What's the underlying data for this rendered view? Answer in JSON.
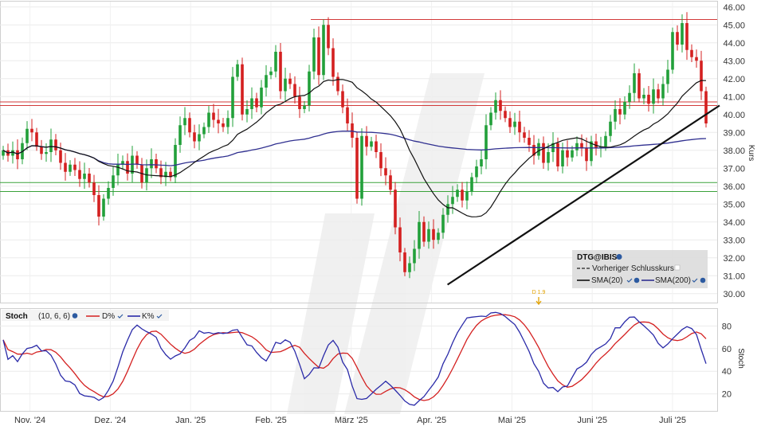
{
  "chart_data": [
    {
      "type": "candlestick",
      "instrument": "DTG@IBIS",
      "ylabel": "Kurs",
      "ylim": [
        29.5,
        46.3
      ],
      "y_ticks": [
        "30.00",
        "31.00",
        "32.00",
        "33.00",
        "34.00",
        "35.00",
        "36.00",
        "37.00",
        "38.00",
        "39.00",
        "40.00",
        "41.00",
        "42.00",
        "43.00",
        "44.00",
        "45.00",
        "46.00"
      ],
      "x_labels": [
        "Nov. '24",
        "Dez. '24",
        "Jan. '25",
        "Feb. '25",
        "März '25",
        "Apr. '25",
        "Mai '25",
        "Juni '25",
        "Juli '25"
      ],
      "event_marker": "D 1.9",
      "horizontal_levels": [
        {
          "value": 45.3,
          "color": "#d23a3a"
        },
        {
          "value": 40.7,
          "color": "#d23a3a"
        },
        {
          "value": 40.5,
          "color": "#d23a3a"
        },
        {
          "value": 36.2,
          "color": "#3aa23a"
        },
        {
          "value": 35.7,
          "color": "#3aa23a"
        }
      ],
      "trendline": {
        "from": {
          "x": "Apr. '25",
          "y": 30.5
        },
        "to": {
          "x": "Juli '25 end",
          "y": 40.5
        }
      },
      "closes": [
        38.0,
        37.7,
        38.0,
        37.5,
        38.4,
        39.2,
        39.0,
        38.2,
        37.8,
        37.9,
        38.6,
        38.0,
        37.3,
        36.8,
        37.2,
        36.9,
        36.4,
        36.7,
        36.2,
        35.5,
        34.3,
        35.3,
        35.9,
        36.6,
        37.2,
        37.4,
        36.7,
        37.7,
        37.2,
        36.2,
        37.0,
        37.5,
        37.0,
        36.5,
        36.8,
        36.5,
        38.3,
        39.4,
        39.8,
        39.0,
        38.5,
        38.9,
        39.3,
        40.1,
        39.7,
        39.5,
        39.3,
        39.8,
        42.1,
        42.8,
        40.0,
        40.3,
        40.9,
        40.4,
        41.5,
        42.2,
        42.4,
        43.5,
        41.3,
        42.0,
        41.7,
        41.0,
        40.3,
        40.5,
        42.4,
        44.3,
        42.2,
        45.0,
        43.7,
        42.1,
        41.3,
        40.4,
        39.5,
        38.7,
        35.3,
        38.8,
        38.2,
        38.5,
        37.9,
        37.0,
        36.6,
        35.8,
        33.7,
        32.3,
        31.2,
        31.7,
        32.5,
        34.0,
        32.9,
        33.6,
        33.0,
        33.4,
        34.4,
        35.0,
        35.4,
        35.8,
        35.2,
        35.7,
        36.5,
        37.1,
        37.5,
        39.4,
        40.1,
        40.8,
        40.2,
        39.8,
        39.3,
        39.6,
        39.0,
        38.7,
        38.3,
        37.7,
        38.4,
        37.3,
        37.9,
        38.4,
        37.1,
        38.0,
        37.6,
        38.0,
        38.4,
        38.1,
        37.4,
        38.5,
        38.1,
        38.2,
        38.8,
        39.6,
        40.3,
        40.0,
        40.7,
        41.2,
        42.3,
        40.9,
        41.1,
        40.6,
        41.4,
        40.9,
        41.7,
        42.5,
        44.6,
        43.9,
        45.1,
        43.6,
        43.2,
        43.0,
        41.3,
        39.5
      ],
      "stoch_params": "(10, 6, 6)",
      "stoch_ylim": [
        5,
        95
      ],
      "stoch_ticks": [
        "20",
        "40",
        "60",
        "80"
      ],
      "stoch_ylabel": "Stoch",
      "series": [
        {
          "name": "Vorheriger Schlusskurs",
          "color": "#222222"
        },
        {
          "name": "SMA(20)",
          "color": "#111111",
          "window": 20
        },
        {
          "name": "SMA(200)",
          "color": "#303090",
          "window": 200
        },
        {
          "name": "D%",
          "color": "#d42020"
        },
        {
          "name": "K%",
          "color": "#2a2aa8"
        }
      ]
    }
  ],
  "legend": {
    "title": "DTG@IBIS",
    "prev_close": "Vorheriger Schlusskurs",
    "sma20": "SMA(20)",
    "sma200": "SMA(200)"
  },
  "stoch_header": {
    "name": "Stoch",
    "params": "(10, 6, 6)",
    "d_label": "D%",
    "k_label": "K%"
  },
  "y_axis_title": "Kurs",
  "stoch_axis_title": "Stoch",
  "event_marker": "D 1.9"
}
